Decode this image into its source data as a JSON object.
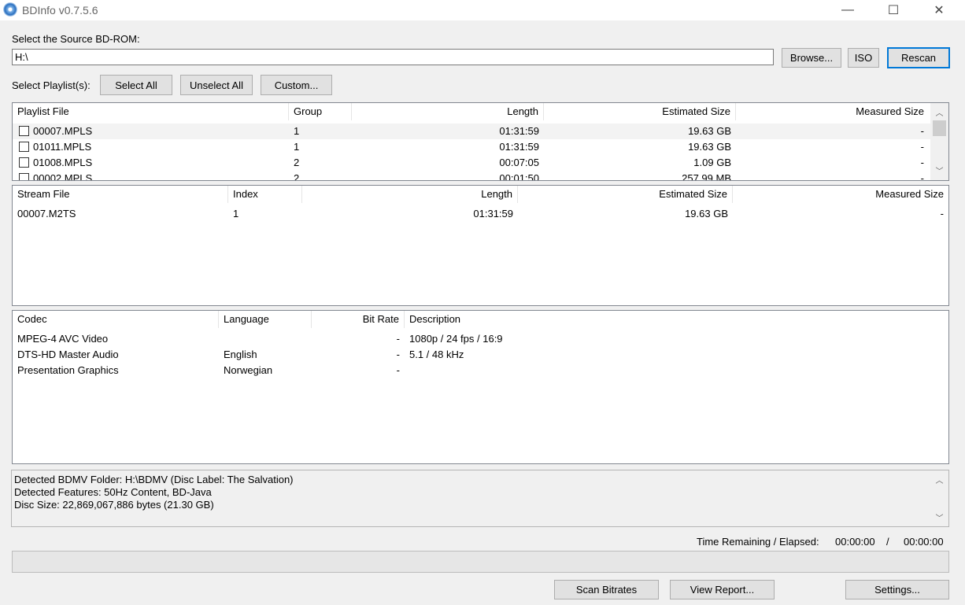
{
  "window": {
    "title": "BDInfo v0.7.5.6",
    "minimize": "—",
    "maximize": "☐",
    "close": "✕"
  },
  "source": {
    "label": "Select the Source BD-ROM:",
    "path": "H:\\",
    "browse": "Browse...",
    "iso": "ISO",
    "rescan": "Rescan"
  },
  "playlists_bar": {
    "label": "Select Playlist(s):",
    "select_all": "Select All",
    "unselect_all": "Unselect All",
    "custom": "Custom..."
  },
  "playlists": {
    "headers": [
      "Playlist File",
      "Group",
      "Length",
      "Estimated Size",
      "Measured Size"
    ],
    "rows": [
      {
        "file": "00007.MPLS",
        "group": "1",
        "length": "01:31:59",
        "est": "19.63 GB",
        "meas": "-",
        "checked": false,
        "selected": true
      },
      {
        "file": "01011.MPLS",
        "group": "1",
        "length": "01:31:59",
        "est": "19.63 GB",
        "meas": "-",
        "checked": false
      },
      {
        "file": "01008.MPLS",
        "group": "2",
        "length": "00:07:05",
        "est": "1.09 GB",
        "meas": "-",
        "checked": false
      },
      {
        "file": "00002.MPLS",
        "group": "2",
        "length": "00:01:50",
        "est": "257.99 MB",
        "meas": "-",
        "checked": false
      }
    ]
  },
  "streams": {
    "headers": [
      "Stream File",
      "Index",
      "Length",
      "Estimated Size",
      "Measured Size"
    ],
    "rows": [
      {
        "file": "00007.M2TS",
        "index": "1",
        "length": "01:31:59",
        "est": "19.63 GB",
        "meas": "-"
      }
    ]
  },
  "codecs": {
    "headers": [
      "Codec",
      "Language",
      "Bit Rate",
      "Description"
    ],
    "rows": [
      {
        "codec": "MPEG-4 AVC Video",
        "lang": "",
        "bitrate": "-",
        "desc": "1080p / 24 fps / 16:9"
      },
      {
        "codec": "DTS-HD Master Audio",
        "lang": "English",
        "bitrate": "-",
        "desc": "5.1 / 48 kHz"
      },
      {
        "codec": "Presentation Graphics",
        "lang": "Norwegian",
        "bitrate": "-",
        "desc": ""
      }
    ]
  },
  "info": {
    "lines": [
      "Detected BDMV Folder: H:\\BDMV (Disc Label: The Salvation)",
      "Detected Features: 50Hz Content, BD-Java",
      "Disc Size: 22,869,067,886 bytes (21.30 GB)"
    ]
  },
  "timer": {
    "label": "Time Remaining / Elapsed:",
    "remaining": "00:00:00",
    "separator": "/",
    "elapsed": "00:00:00"
  },
  "progress": {
    "value": 0
  },
  "footer": {
    "scan": "Scan Bitrates",
    "report": "View Report...",
    "settings": "Settings..."
  },
  "icons": {
    "app": "disc-icon",
    "scroll_up": "chevron-up-icon",
    "scroll_down": "chevron-down-icon"
  }
}
